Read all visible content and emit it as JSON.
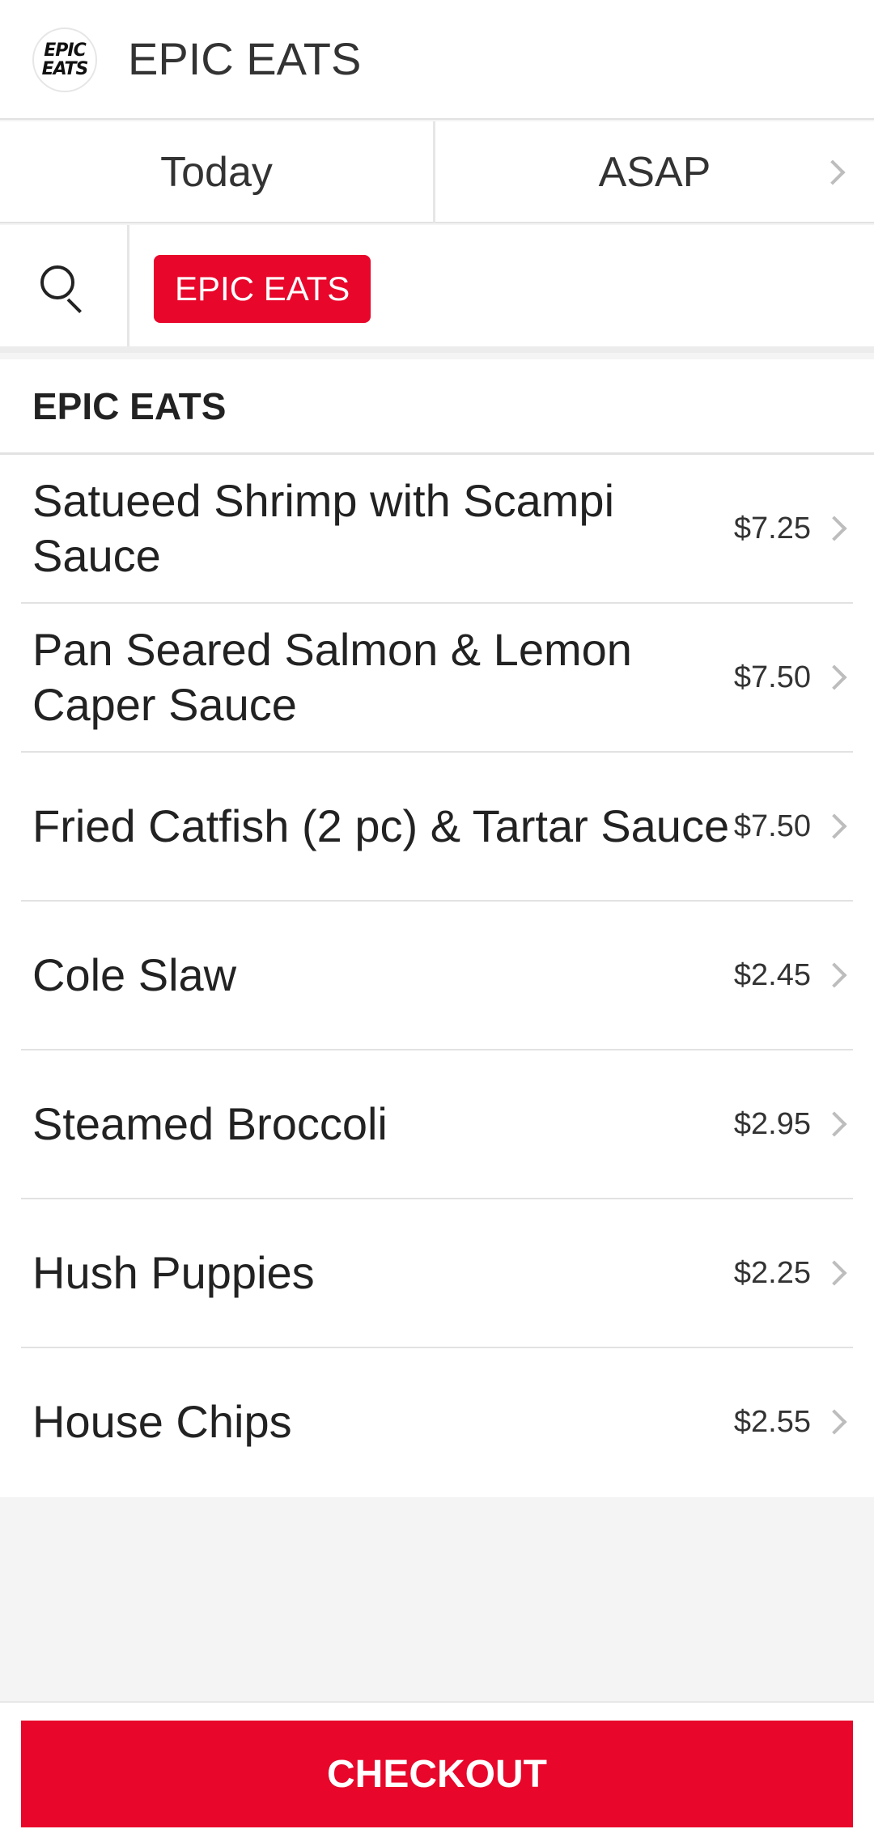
{
  "header": {
    "logo_line1": "EPIC",
    "logo_line2": "EATS",
    "title": "EPIC EATS"
  },
  "schedule": {
    "day": "Today",
    "time": "ASAP"
  },
  "filter": {
    "search_icon": "search-icon",
    "active_chip": "EPIC EATS"
  },
  "section": {
    "title": "EPIC EATS",
    "items": [
      {
        "name": "Satueed Shrimp with Scampi Sauce",
        "price": "$7.25"
      },
      {
        "name": "Pan Seared Salmon & Lemon Caper Sauce",
        "price": "$7.50"
      },
      {
        "name": "Fried Catfish (2 pc) & Tartar Sauce",
        "price": "$7.50"
      },
      {
        "name": "Cole Slaw",
        "price": "$2.45"
      },
      {
        "name": "Steamed Broccoli",
        "price": "$2.95"
      },
      {
        "name": "Hush Puppies",
        "price": "$2.25"
      },
      {
        "name": "House Chips",
        "price": "$2.55"
      }
    ]
  },
  "footer": {
    "checkout_label": "CHECKOUT"
  },
  "colors": {
    "accent": "#e8062a",
    "background": "#f4f4f4",
    "surface": "#ffffff"
  }
}
